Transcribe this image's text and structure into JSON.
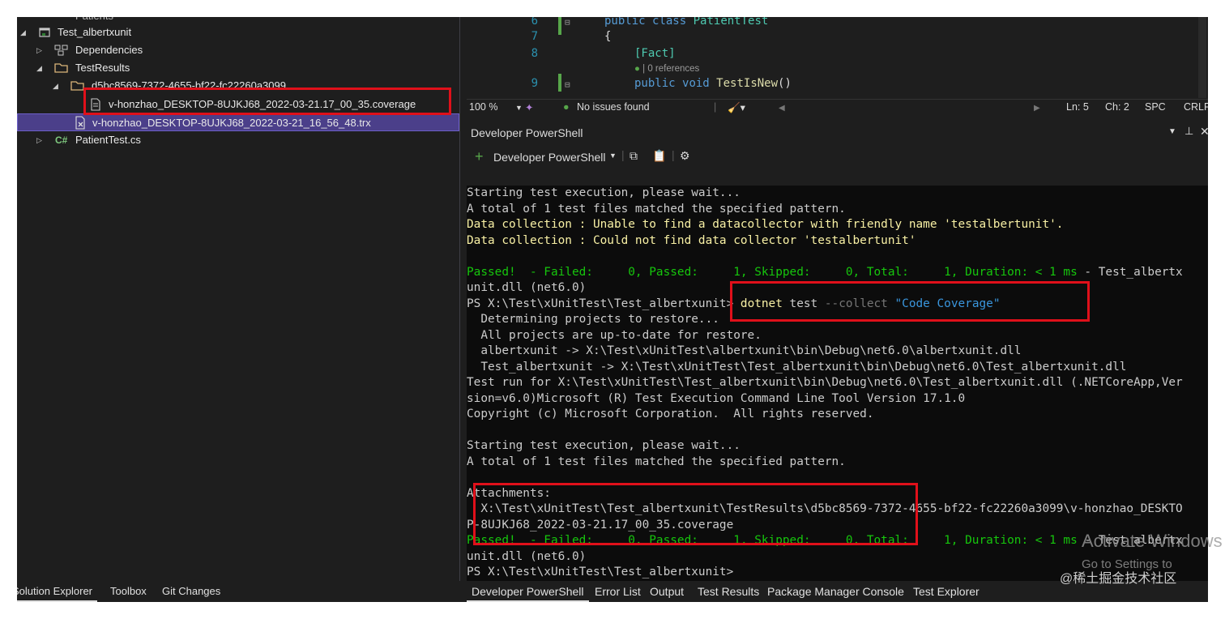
{
  "solution_explorer": {
    "items": [
      {
        "label": "Patients",
        "icon": "folder-icon",
        "state": "partial"
      },
      {
        "label": "Test_albertxunit",
        "icon": "test-project-icon"
      },
      {
        "label": "Dependencies",
        "icon": "dependencies-icon"
      },
      {
        "label": "TestResults",
        "icon": "folder-icon"
      },
      {
        "label": "d5bc8569-7372-4655-bf22-fc22260a3099",
        "icon": "folder-icon"
      },
      {
        "label": "v-honzhao_DESKTOP-8UJKJ68_2022-03-21.17_00_35.coverage",
        "icon": "file-icon"
      },
      {
        "label": "v-honzhao_DESKTOP-8UJKJ68_2022-03-21_16_56_48.trx",
        "icon": "test-results-file-icon"
      },
      {
        "label": "PatientTest.cs",
        "icon": "csharp-file-icon",
        "prefix": "C#"
      }
    ]
  },
  "left_tabs": [
    "Solution Explorer",
    "Toolbox",
    "Git Changes"
  ],
  "editor": {
    "lines": [
      {
        "num": "6",
        "text": "public class PatientTest"
      },
      {
        "num": "7",
        "text": "{"
      },
      {
        "num": "8",
        "text": "[Fact]"
      },
      {
        "num": "",
        "text": "0 references"
      },
      {
        "num": "9",
        "text": "public void TestIsNew()"
      }
    ]
  },
  "status": {
    "zoom": "100 %",
    "issues": "No issues found",
    "ln": "Ln: 5",
    "ch": "Ch: 2",
    "spc": "SPC",
    "crlf": "CRLF"
  },
  "terminal_panel": {
    "title": "Developer PowerShell",
    "new_tab_label": "Developer PowerShell"
  },
  "terminal_lines": [
    {
      "parts": [
        {
          "t": "Starting test execution, please wait...",
          "c": ""
        }
      ]
    },
    {
      "parts": [
        {
          "t": "A total of 1 test files matched the specified pattern.",
          "c": ""
        }
      ]
    },
    {
      "parts": [
        {
          "t": "Data collection : Unable to find a datacollector with friendly name 'testalbertunit'.",
          "c": "yel"
        }
      ]
    },
    {
      "parts": [
        {
          "t": "Data collection : Could not find data collector 'testalbertunit'",
          "c": "yel"
        }
      ]
    },
    {
      "parts": [
        {
          "t": "",
          "c": ""
        }
      ]
    },
    {
      "parts": [
        {
          "t": "Passed!  - Failed:     0, Passed:     1, Skipped:     0, Total:     1, Duration: < 1 ms",
          "c": "brightgreen"
        },
        {
          "t": " - Test_albertx",
          "c": ""
        }
      ]
    },
    {
      "parts": [
        {
          "t": "unit.dll (net6.0)",
          "c": ""
        }
      ]
    },
    {
      "parts": [
        {
          "t": "PS X:\\Test\\xUnitTest\\Test_albertxunit> ",
          "c": ""
        },
        {
          "t": "dotnet",
          "c": "yel"
        },
        {
          "t": " test ",
          "c": ""
        },
        {
          "t": "--collect",
          "c": "gry"
        },
        {
          "t": " \"Code Coverage\"",
          "c": "cyn"
        }
      ]
    },
    {
      "parts": [
        {
          "t": "  Determining projects to restore...",
          "c": ""
        }
      ]
    },
    {
      "parts": [
        {
          "t": "  All projects are up-to-date for restore.",
          "c": ""
        }
      ]
    },
    {
      "parts": [
        {
          "t": "  albertxunit -> X:\\Test\\xUnitTest\\albertxunit\\bin\\Debug\\net6.0\\albertxunit.dll",
          "c": ""
        }
      ]
    },
    {
      "parts": [
        {
          "t": "  Test_albertxunit -> X:\\Test\\xUnitTest\\Test_albertxunit\\bin\\Debug\\net6.0\\Test_albertxunit.dll",
          "c": ""
        }
      ]
    },
    {
      "parts": [
        {
          "t": "Test run for X:\\Test\\xUnitTest\\Test_albertxunit\\bin\\Debug\\net6.0\\Test_albertxunit.dll (.NETCoreApp,Ver",
          "c": ""
        }
      ]
    },
    {
      "parts": [
        {
          "t": "sion=v6.0)Microsoft (R) Test Execution Command Line Tool Version 17.1.0",
          "c": ""
        }
      ]
    },
    {
      "parts": [
        {
          "t": "Copyright (c) Microsoft Corporation.  All rights reserved.",
          "c": ""
        }
      ]
    },
    {
      "parts": [
        {
          "t": "",
          "c": ""
        }
      ]
    },
    {
      "parts": [
        {
          "t": "Starting test execution, please wait...",
          "c": ""
        }
      ]
    },
    {
      "parts": [
        {
          "t": "A total of 1 test files matched the specified pattern.",
          "c": ""
        }
      ]
    },
    {
      "parts": [
        {
          "t": "",
          "c": ""
        }
      ]
    },
    {
      "parts": [
        {
          "t": "Attachments:",
          "c": ""
        }
      ]
    },
    {
      "parts": [
        {
          "t": "  X:\\Test\\xUnitTest\\Test_albertxunit\\TestResults\\d5bc8569-7372-4655-bf22-fc22260a3099\\v-honzhao_DESKTO",
          "c": ""
        }
      ]
    },
    {
      "parts": [
        {
          "t": "P-8UJKJ68_2022-03-21.17_00_35.coverage",
          "c": ""
        }
      ]
    },
    {
      "parts": [
        {
          "t": "Passed!  - Failed:     0, Passed:     1, Skipped:     0, Total:     1, Duration: < 1 ms",
          "c": "brightgreen"
        },
        {
          "t": " - Test_albertx",
          "c": ""
        }
      ]
    },
    {
      "parts": [
        {
          "t": "unit.dll (net6.0)",
          "c": ""
        }
      ]
    },
    {
      "parts": [
        {
          "t": "PS X:\\Test\\xUnitTest\\Test_albertxunit>",
          "c": ""
        }
      ]
    }
  ],
  "bottom_tabs": [
    "Developer PowerShell",
    "Error List",
    "Output",
    "Test Results",
    "Package Manager Console",
    "Test Explorer"
  ],
  "watermark": {
    "activate": "Activate Windows",
    "goto": "Go to Settings to",
    "site": "@稀土掘金技术社区"
  },
  "colors": {
    "highlight_box": "#e0101a",
    "selection": "#4b3f8a",
    "terminal_yellow": "#f9f1a5",
    "terminal_green": "#16c60c"
  }
}
